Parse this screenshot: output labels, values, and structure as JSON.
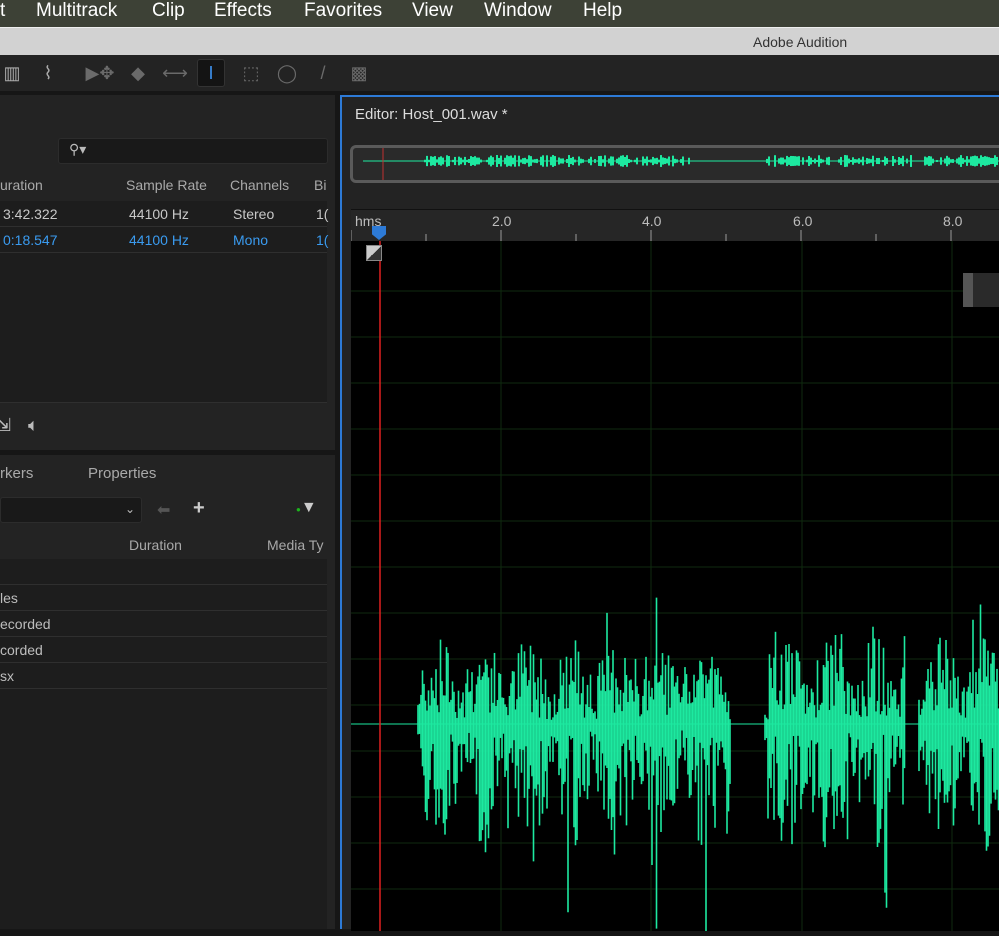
{
  "menu": [
    "t",
    "Multitrack",
    "Clip",
    "Effects",
    "Favorites",
    "View",
    "Window",
    "Help"
  ],
  "app_title": "Adobe Audition",
  "toolbar": {
    "tools": [
      "spectral-view-icon",
      "waveform-view-icon",
      "move-icon",
      "razor-icon",
      "slip-icon",
      "time-selection-icon",
      "marquee-icon",
      "lasso-icon",
      "brush-icon",
      "spot-healing-icon"
    ],
    "active": "time-selection-icon"
  },
  "files": {
    "search_placeholder": "",
    "columns": [
      "uration",
      "Sample Rate",
      "Channels",
      "Bi"
    ],
    "rows": [
      {
        "duration": "3:42.322",
        "rate": "44100 Hz",
        "channels": "Stereo",
        "bits": "1(",
        "selected": false
      },
      {
        "duration": "0:18.547",
        "rate": "44100 Hz",
        "channels": "Mono",
        "bits": "1(",
        "selected": true
      }
    ]
  },
  "markers": {
    "tabs": [
      "rkers",
      "Properties"
    ],
    "columns": [
      "Duration",
      "Media Ty"
    ],
    "rows": [
      "",
      "les",
      "ecorded",
      "corded",
      "sx"
    ]
  },
  "editor": {
    "title": "Editor: Host_001.wav *",
    "ruler_unit": "hms",
    "ticks": [
      "2.0",
      "4.0",
      "6.0",
      "8.0"
    ],
    "waveform_color": "#1de9a0",
    "playhead_color": "#e02020",
    "accent": "#2d7ad6"
  }
}
